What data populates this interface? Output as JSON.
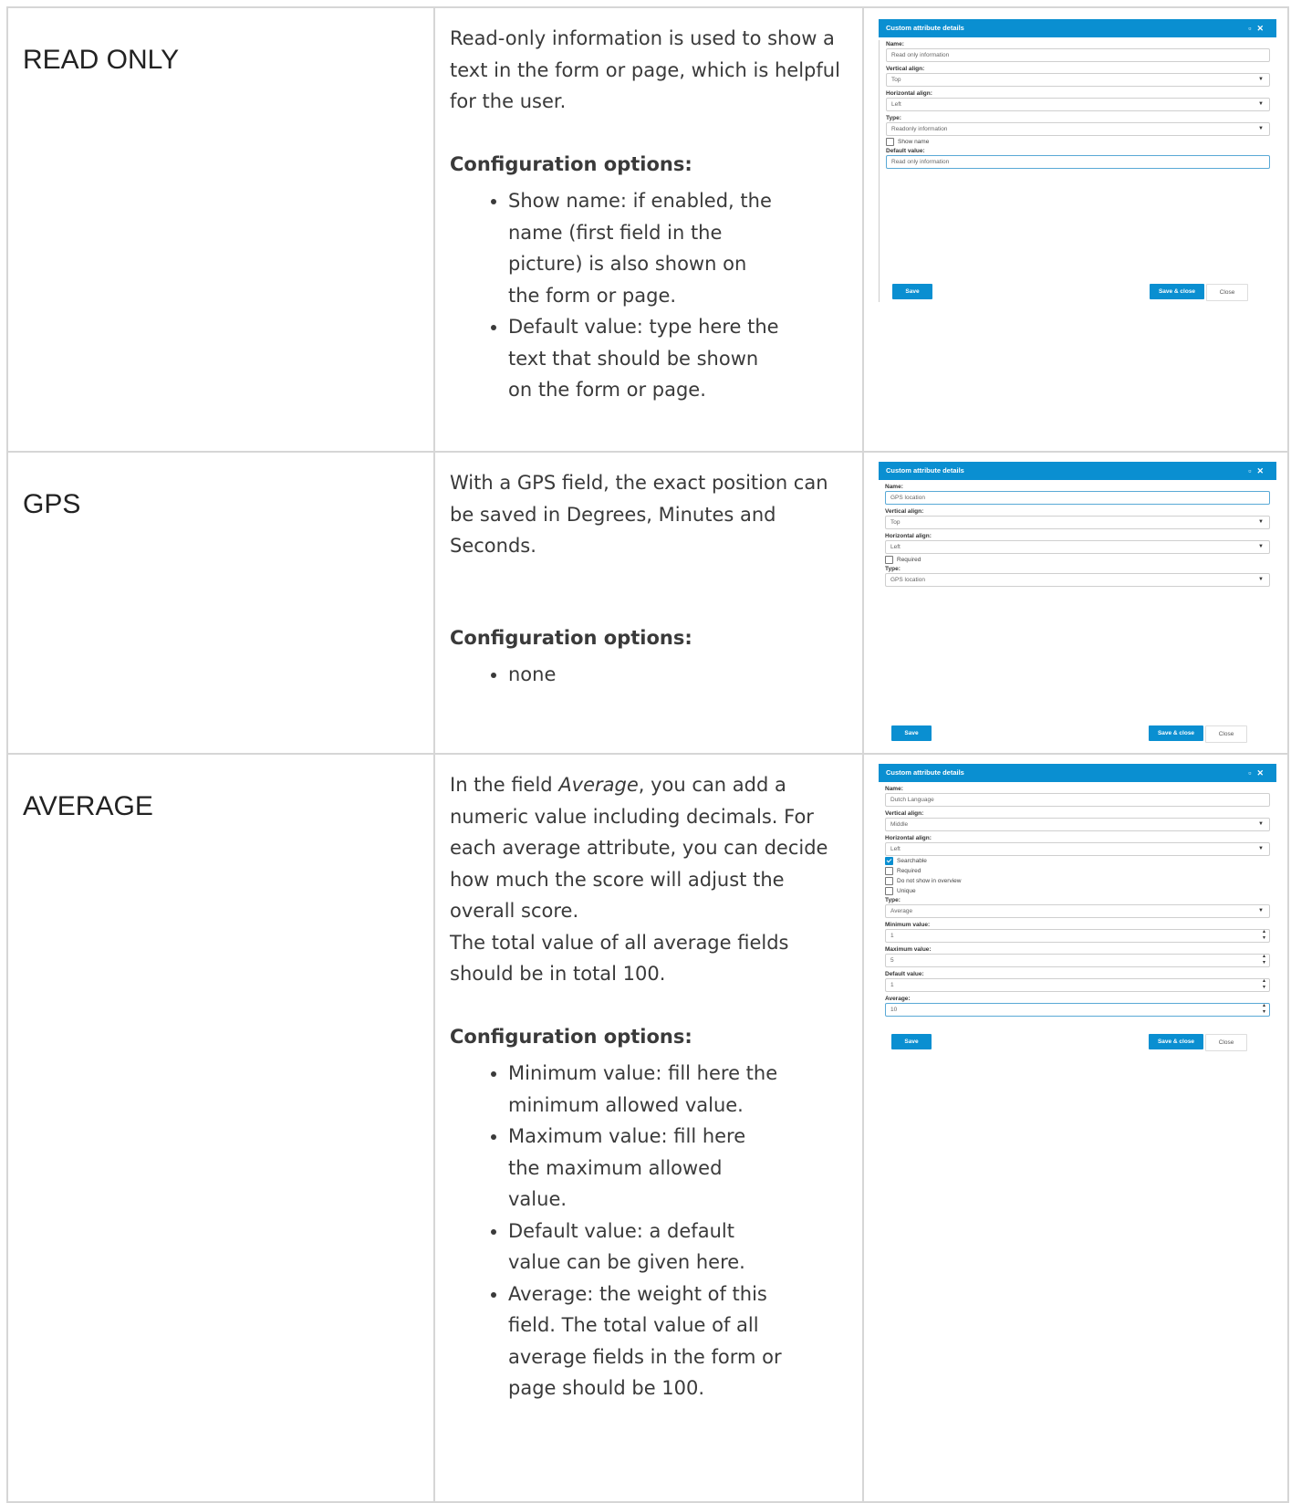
{
  "rows": [
    {
      "name": "READ ONLY",
      "intro": "Read-only information is used to show a text in the form or page, which is helpful for the user.",
      "config_heading": "Configuration options:",
      "options": [
        "Show name: if enabled, the name (first field in the picture) is also shown on the form or page.",
        "Default value: type here the text that should be shown on the form or page."
      ],
      "dialog": {
        "title": "Custom attribute details",
        "name_label": "Name:",
        "name_value": "Read only information",
        "valign_label": "Vertical align:",
        "valign_value": "Top",
        "halign_label": "Horizontal align:",
        "halign_value": "Left",
        "type_label": "Type:",
        "type_value": "Readonly information",
        "show_name_label": "Show name",
        "default_label": "Default value:",
        "default_value": "Read only information",
        "save": "Save",
        "save_close": "Save & close",
        "close": "Close"
      }
    },
    {
      "name": "GPS",
      "intro": "With a GPS field, the exact position can be saved in Degrees, Minutes and Seconds.",
      "config_heading": "Configuration options:",
      "options": [
        "none"
      ],
      "dialog": {
        "title": "Custom attribute details",
        "name_label": "Name:",
        "name_value": "GPS location",
        "valign_label": "Vertical align:",
        "valign_value": "Top",
        "halign_label": "Horizontal align:",
        "halign_value": "Left",
        "required_label": "Required",
        "type_label": "Type:",
        "type_value": "GPS location",
        "save": "Save",
        "save_close": "Save & close",
        "close": "Close"
      }
    },
    {
      "name": "AVERAGE",
      "intro_pre": "In the field ",
      "intro_em": "Average",
      "intro_post": ", you can add a numeric value including decimals. For each average attribute, you can decide how much the score will adjust the overall score.",
      "intro2": "The total value of all average fields should be in total 100.",
      "config_heading": "Configuration options:",
      "options": [
        "Minimum value: fill here the minimum allowed value.",
        "Maximum value: fill here the maximum allowed value.",
        "Default value: a default value can be given here.",
        "Average: the weight of this field. The total value of all average fields in the form or page should be 100."
      ],
      "dialog": {
        "title": "Custom attribute details",
        "name_label": "Name:",
        "name_value": "Dutch Language",
        "valign_label": "Vertical align:",
        "valign_value": "Middle",
        "halign_label": "Horizontal align:",
        "halign_value": "Left",
        "searchable_label": "Searchable",
        "required_label": "Required",
        "overview_label": "Do not show in overview",
        "unique_label": "Unique",
        "type_label": "Type:",
        "type_value": "Average",
        "min_label": "Minimum value:",
        "min_value": "1",
        "max_label": "Maximum value:",
        "max_value": "5",
        "default_label": "Default value:",
        "default_value": "1",
        "average_label": "Average:",
        "average_value": "10",
        "save": "Save",
        "save_close": "Save & close",
        "close": "Close"
      }
    }
  ],
  "icons": {
    "maximize": "maximize-icon",
    "close": "close-icon",
    "dropdown": "chevron-down-icon",
    "spinner": "spinner-arrows-icon"
  },
  "colors": {
    "accent": "#0a8fd1",
    "border": "#d6d6d6"
  }
}
